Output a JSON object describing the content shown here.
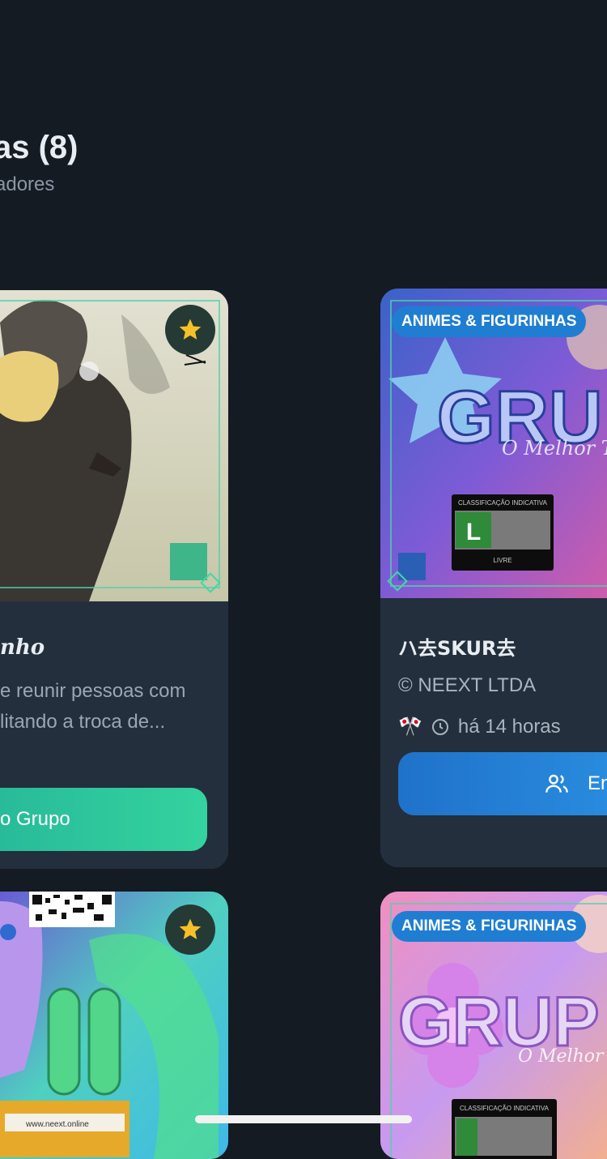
{
  "section": {
    "title": "as (8)",
    "subtitle": "adores"
  },
  "cards": [
    {
      "name": "nho",
      "description_line1": "e reunir pessoas com",
      "description_line2": "litando a troca de...",
      "button_label": "o Grupo"
    },
    {
      "badge": "ANIMES & FIGURINHAS",
      "name": "ハ去SKUR去",
      "owner": "© NEEXT LTDA",
      "flag": "🎌",
      "time": "há 14 horas",
      "button_label": "En",
      "rating_header": "CLASSIFICAÇÃO INDICATIVA",
      "rating_letter": "L",
      "rating_footer": "LIVRE",
      "image_title": "GRU",
      "image_tagline": "O Melhor Te"
    },
    {
      "url_text": "www.neext.online"
    },
    {
      "badge": "ANIMES & FIGURINHAS",
      "rating_header": "CLASSIFICAÇÃO INDICATIVA",
      "image_title": "GRUP",
      "image_tagline": "O Melhor Te"
    }
  ]
}
